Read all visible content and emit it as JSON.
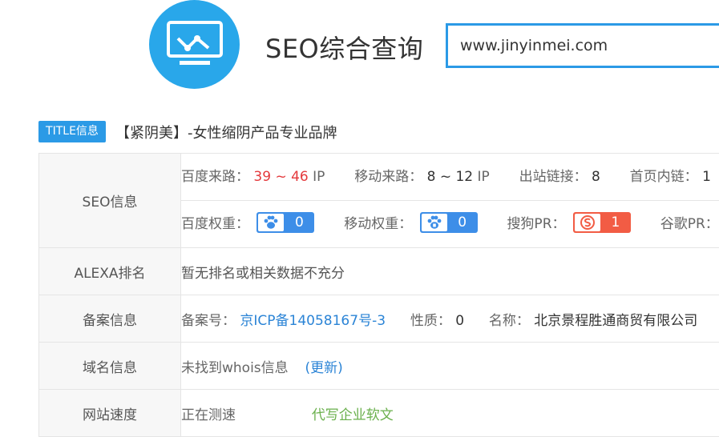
{
  "header": {
    "title": "SEO综合查询",
    "search_value": "www.jinyinmei.com",
    "logo_icon": "monitor-chart-icon"
  },
  "site_title": {
    "badge": "TITLE信息",
    "text": "【紧阴美】-女性缩阴产品专业品牌"
  },
  "seo": {
    "label": "SEO信息",
    "baidu_traffic_label": "百度来路：",
    "baidu_traffic_value": "39 ~ 46",
    "baidu_traffic_unit": "IP",
    "mobile_traffic_label": "移动来路：",
    "mobile_traffic_value": "8 ~ 12",
    "mobile_traffic_unit": "IP",
    "outbound_label": "出站链接：",
    "outbound_value": "8",
    "homepage_links_label": "首页内链：",
    "homepage_links_value": "1",
    "baidu_weight_label": "百度权重：",
    "baidu_weight_value": "0",
    "mobile_weight_label": "移动权重：",
    "mobile_weight_value": "0",
    "sogou_pr_label": "搜狗PR：",
    "sogou_pr_value": "1",
    "google_pr_label": "谷歌PR："
  },
  "alexa": {
    "label": "ALEXA排名",
    "value": "暂无排名或相关数据不充分"
  },
  "icp": {
    "label": "备案信息",
    "number_label": "备案号：",
    "number_value": "京ICP备14058167号-3",
    "type_label": "性质：",
    "type_value": "0",
    "name_label": "名称：",
    "name_value": "北京景程胜通商贸有限公司"
  },
  "domain": {
    "label": "域名信息",
    "value": "未找到whois信息",
    "refresh": "(更新)"
  },
  "speed": {
    "label": "网站速度",
    "value": "正在测速",
    "ad": "代写企业软文"
  },
  "colors": {
    "accent": "#2b9ae6",
    "logo": "#29a7ea",
    "baidu_badge": "#3d8ee8",
    "sogou_badge": "#f25c44",
    "google_badge": "#35a853",
    "traffic_red": "#e4393c",
    "link_blue": "#2b84d6",
    "ad_green": "#6ab04c"
  }
}
